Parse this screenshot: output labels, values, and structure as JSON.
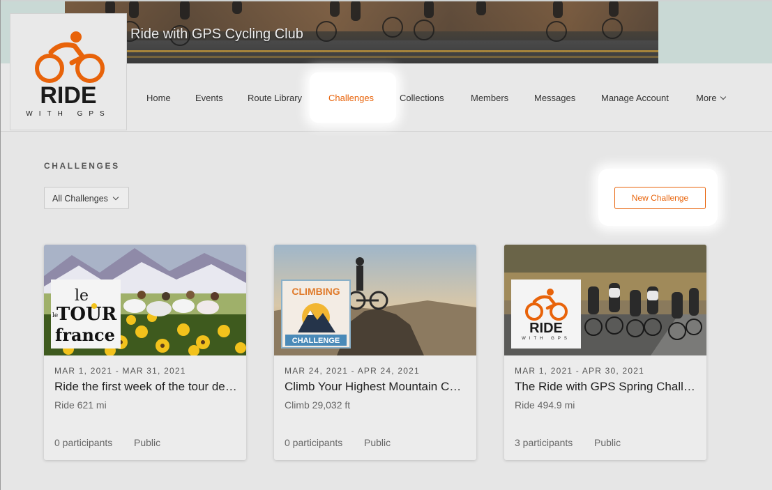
{
  "club": {
    "title": "Ride with GPS Cycling Club"
  },
  "logo": {
    "word": "RIDE",
    "sub": "WITH GPS"
  },
  "nav": {
    "items": [
      {
        "label": "Home"
      },
      {
        "label": "Events"
      },
      {
        "label": "Route Library"
      },
      {
        "label": "Challenges",
        "active": true
      },
      {
        "label": "Collections"
      },
      {
        "label": "Members"
      },
      {
        "label": "Messages"
      },
      {
        "label": "Manage Account"
      },
      {
        "label": "More"
      }
    ]
  },
  "challenges": {
    "section_title": "CHALLENGES",
    "filter_selected": "All Challenges",
    "new_button": "New Challenge",
    "cards": [
      {
        "dates": "MAR 1, 2021 - MAR 31, 2021",
        "title": "Ride the first week of the tour de France",
        "stat": "Ride 621 mi",
        "participants": "0 participants",
        "visibility": "Public",
        "badge": "le tour de france logo"
      },
      {
        "dates": "MAR 24, 2021 - APR 24, 2021",
        "title": "Climb Your Highest Mountain Challenge",
        "stat": "Climb 29,032 ft",
        "participants": "0 participants",
        "visibility": "Public",
        "badge_top": "CLIMBING",
        "badge_bottom": "CHALLENGE"
      },
      {
        "dates": "MAR 1, 2021 - APR 30, 2021",
        "title": "The Ride with GPS Spring Challenge",
        "stat": "Ride 494.9 mi",
        "participants": "3 participants",
        "visibility": "Public",
        "badge_word": "RIDE",
        "badge_sub": "WITH GPS"
      }
    ]
  },
  "colors": {
    "accent": "#e8630a",
    "background": "#e6e6e6"
  }
}
